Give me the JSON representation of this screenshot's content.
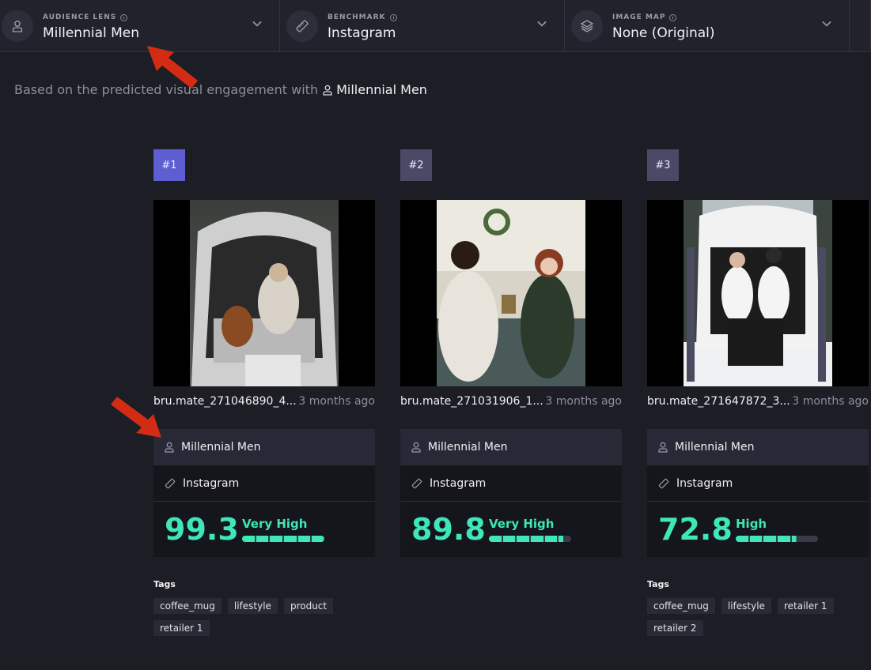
{
  "filters": [
    {
      "label": "AUDIENCE LENS",
      "value": "Millennial Men",
      "icon": "person-icon"
    },
    {
      "label": "BENCHMARK",
      "value": "Instagram",
      "icon": "ruler-icon"
    },
    {
      "label": "IMAGE MAP",
      "value": "None (Original)",
      "icon": "layers-icon"
    }
  ],
  "subtitle": {
    "text": "Based on the predicted visual engagement with",
    "audience": "Millennial Men"
  },
  "cards": [
    {
      "rank": "#1",
      "filename": "bru.mate_271046890_4...",
      "age": "3 months ago",
      "audience": "Millennial Men",
      "benchmark": "Instagram",
      "score": "99.3",
      "level": "Very High",
      "score_fraction": 0.993,
      "tags_title": "Tags",
      "tags": [
        "coffee_mug",
        "lifestyle",
        "product",
        "retailer 1"
      ]
    },
    {
      "rank": "#2",
      "filename": "bru.mate_271031906_1...",
      "age": "3 months ago",
      "audience": "Millennial Men",
      "benchmark": "Instagram",
      "score": "89.8",
      "level": "Very High",
      "score_fraction": 0.898,
      "tags_title": "",
      "tags": []
    },
    {
      "rank": "#3",
      "filename": "bru.mate_271647872_3...",
      "age": "3 months ago",
      "audience": "Millennial Men",
      "benchmark": "Instagram",
      "score": "72.8",
      "level": "High",
      "score_fraction": 0.728,
      "tags_title": "Tags",
      "tags": [
        "coffee_mug",
        "lifestyle",
        "retailer 1",
        "retailer 2"
      ]
    }
  ],
  "colors": {
    "accent": "#3ee6b8",
    "rank_first": "#5d5fd0",
    "rank_other": "#4a4a66",
    "arrow": "#d42c14"
  }
}
